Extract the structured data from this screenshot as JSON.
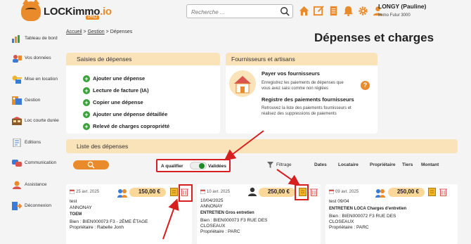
{
  "app": {
    "brand_main": "LOCKimmo",
    "brand_suffix": ".io",
    "brand_badge": "PRO"
  },
  "search": {
    "placeholder": "Recherche ..."
  },
  "user": {
    "name": "LONGY (Pauline)",
    "org": "Immo Futur 3000"
  },
  "sidebar": {
    "items": [
      {
        "label": "Tableau de bord",
        "icon": "dashboard-icon"
      },
      {
        "label": "Vos données",
        "icon": "data-icon"
      },
      {
        "label": "Mise en location",
        "icon": "rental-icon"
      },
      {
        "label": "Gestion",
        "icon": "management-icon"
      },
      {
        "label": "Loc courte durée",
        "icon": "short-term-icon"
      },
      {
        "label": "Editions",
        "icon": "editions-icon"
      },
      {
        "label": "Communication",
        "icon": "communication-icon"
      },
      {
        "label": "Assistance",
        "icon": "assistance-icon"
      },
      {
        "label": "Déconnexion",
        "icon": "logout-icon"
      }
    ]
  },
  "breadcrumb": {
    "home": "Accueil",
    "sep": ">",
    "section": "Gestion",
    "current": "Dépenses"
  },
  "page_title": "Dépenses et charges",
  "saisies": {
    "title": "Saisies de dépenses",
    "actions": [
      "Ajouter une dépense",
      "Lecture de facture (IA)",
      "Copier une dépense",
      "Ajouter une dépense détaillée",
      "Relevé de charges copropriété"
    ]
  },
  "fournisseurs": {
    "title": "Fournisseurs et artisans",
    "pay_title": "Payer vos fournisseurs",
    "pay_desc": "Enregistrez les paiements de dépenses que vous avez saisi comme non réglées",
    "help": "?",
    "registre_title": "Registre des paiements fournisseurs",
    "registre_desc": "Retrouvez la liste des paiements fournisseurs et réalisez des suppressions de paiements"
  },
  "liste": {
    "title": "Liste des dépenses",
    "toggle_left": "A qualifier",
    "toggle_right": "Validées",
    "filtrage": "Filtrage",
    "columns": [
      "Dates",
      "Locataire",
      "Propriétaire",
      "Tiers",
      "Montant"
    ]
  },
  "expenses": [
    {
      "date": "25 avr. 2025",
      "amount": "150,00 €",
      "lines": [
        "test",
        "ANNONAY",
        "TOEM",
        "Bien : BIEN000073 F3 - 2ÈME ÉTAGE",
        "Propriétaire : Rabelle Jonh"
      ]
    },
    {
      "date": "10 avr. 2025",
      "amount": "250,00 €",
      "lines": [
        "10/04/2025",
        "ANNONAY",
        "ENTRETIEN Gros entretien",
        "Bien : BIEN000073 F3 RUE DES",
        "CLOSEAUX",
        "Propriétaire : PARC"
      ]
    },
    {
      "date": "09 avr. 2025",
      "amount": "250,00 €",
      "lines": [
        "test 09/04",
        "ENTRETIEN LOCA Charges d'entretien",
        "Bien : BIEN000072 F3 RUE DES",
        "CLOSEAUX",
        "Propriétaire : PARC"
      ]
    }
  ],
  "colors": {
    "accent": "#e98b2a",
    "highlight": "#d61f1f",
    "header_bg": "#fbe3b9",
    "valid_green": "#1e8a2a"
  }
}
